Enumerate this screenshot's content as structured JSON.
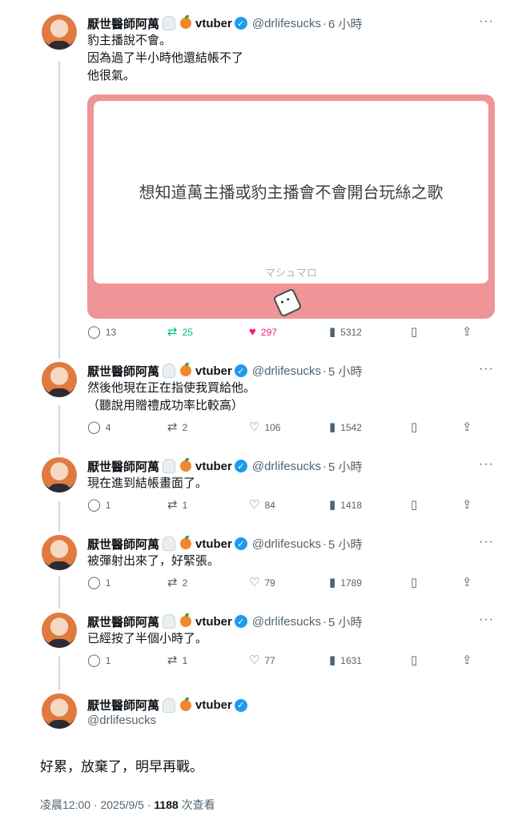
{
  "author": {
    "name": "厭世醫師阿萬",
    "tag": "vtuber",
    "handle": "@drlifesucks"
  },
  "tweets": [
    {
      "time": "6 小時",
      "lines": [
        "豹主播說不會。",
        "因為過了半小時他還結帳不了",
        "他很氣。"
      ],
      "card": {
        "question": "想知道萬主播或豹主播會不會開台玩絲之歌",
        "brand": "マシュマロ"
      },
      "replies": "13",
      "retweets": "25",
      "likes": "297",
      "views": "5312"
    },
    {
      "time": "5 小時",
      "lines": [
        "然後他現在正在指使我買給他。",
        "（聽說用贈禮成功率比較高）"
      ],
      "replies": "4",
      "retweets": "2",
      "likes": "106",
      "views": "1542"
    },
    {
      "time": "5 小時",
      "lines": [
        "現在進到結帳畫面了。"
      ],
      "replies": "1",
      "retweets": "1",
      "likes": "84",
      "views": "1418"
    },
    {
      "time": "5 小時",
      "lines": [
        "被彈射出來了，好緊張。"
      ],
      "replies": "1",
      "retweets": "2",
      "likes": "79",
      "views": "1789"
    },
    {
      "time": "5 小時",
      "lines": [
        "已經按了半個小時了。"
      ],
      "replies": "1",
      "retweets": "1",
      "likes": "77",
      "views": "1631"
    }
  ],
  "final": {
    "text": "好累，放棄了，明早再戰。",
    "timestamp": "凌晨12:00 · 2025/9/5 · ",
    "views_count": "1188",
    "views_label": " 次查看"
  },
  "icons": {
    "reply": "speech-bubble-icon",
    "retweet": "retweet-arrows-icon",
    "like": "heart-icon",
    "views": "bar-chart-icon",
    "bookmark": "bookmark-icon",
    "share": "share-upload-icon",
    "more": "more-dots-icon",
    "verified": "verified-check-icon"
  },
  "colors": {
    "like_active": "#f91880",
    "retweet_active": "#00ba7c",
    "verified": "#1d9bf0",
    "card_bg": "#ef9497"
  }
}
